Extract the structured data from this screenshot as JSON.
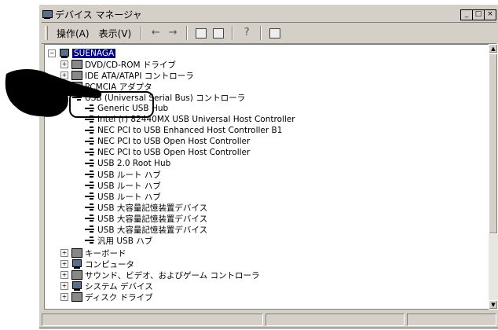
{
  "window": {
    "title": "デバイス マネージャ",
    "buttons": [
      "_",
      "□",
      "×"
    ]
  },
  "toolbar": {
    "menus": [
      "操作(A)",
      "表示(V)"
    ],
    "icons": [
      "back-arrow-icon",
      "forward-arrow-icon",
      "properties-icon",
      "view-icon",
      "help-icon",
      "refresh-icon"
    ]
  },
  "tree": {
    "root": "SUENAGA",
    "categories_top": [
      "DVD/CD-ROM ドライブ",
      "IDE ATA/ATAPI コントローラ",
      "PCMCIA アダプタ",
      "USB (Universal Serial Bus) コントローラ"
    ],
    "usb_devices": [
      "Generic USB Hub",
      "Intel (r) 82440MX USB Universal Host Controller",
      "NEC PCI to USB Enhanced Host Controller B1",
      "NEC PCI to USB Open Host Controller",
      "NEC PCI to USB Open Host Controller",
      "USB 2.0 Root Hub",
      "USB ルート ハブ",
      "USB ルート ハブ",
      "USB ルート ハブ",
      "USB 大容量記憶装置デバイス",
      "USB 大容量記憶装置デバイス",
      "USB 大容量記憶装置デバイス",
      "汎用 USB ハブ"
    ],
    "categories_bottom": [
      "キーボード",
      "コンピュータ",
      "サウンド、ビデオ、およびゲーム コントローラ",
      "システム デバイス",
      "ディスク ドライブ"
    ]
  },
  "colors": {
    "selection": "#000080",
    "window_bg": "#d4d0c8"
  }
}
